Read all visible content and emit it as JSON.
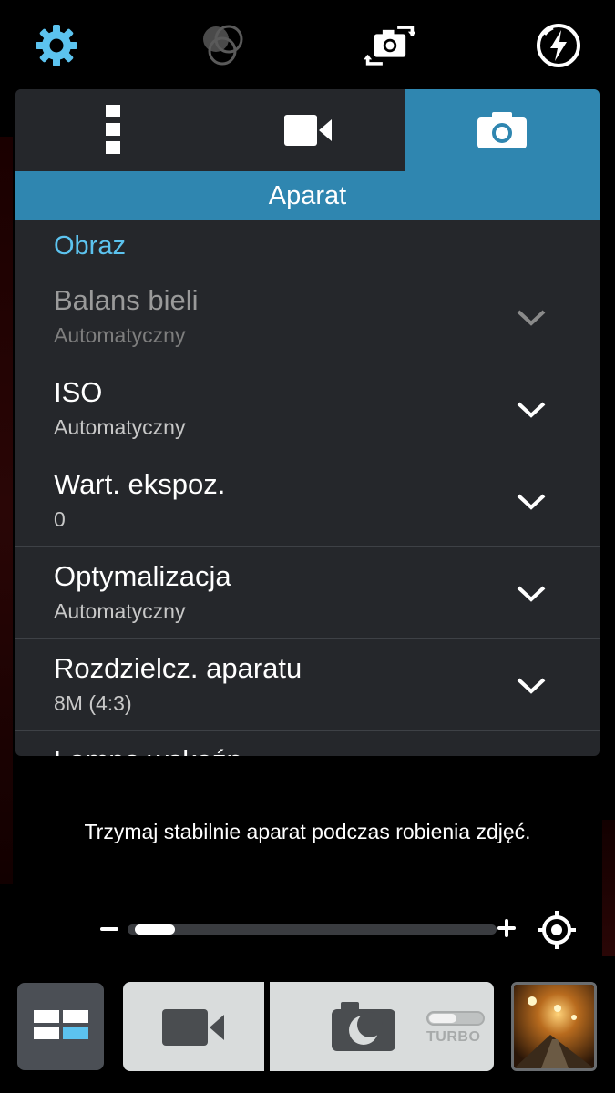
{
  "topbar": {
    "icons": [
      "gear-icon",
      "color-effects-icon",
      "switch-camera-icon",
      "flash-auto-icon"
    ],
    "accent_color": "#5cc3ef"
  },
  "tabs": [
    {
      "icon": "more-vertical-icon",
      "active": false
    },
    {
      "icon": "video-camera-icon",
      "active": false
    },
    {
      "icon": "camera-icon",
      "active": true
    }
  ],
  "panel": {
    "title": "Aparat",
    "section": "Obraz",
    "items": [
      {
        "label": "Balans bieli",
        "value": "Automatyczny",
        "enabled": false
      },
      {
        "label": "ISO",
        "value": "Automatyczny",
        "enabled": true
      },
      {
        "label": "Wart. ekspoz.",
        "value": "0",
        "enabled": true
      },
      {
        "label": "Optymalizacja",
        "value": "Automatyczny",
        "enabled": true
      },
      {
        "label": "Rozdzielcz. aparatu",
        "value": "8M (4:3)",
        "enabled": true
      },
      {
        "label": "Lampa wskaźn",
        "value": "",
        "enabled": true
      }
    ]
  },
  "hint": "Trzymaj stabilnie aparat podczas robienia zdjęć.",
  "zoom": {
    "level": 0.1
  },
  "bottom": {
    "turbo_label": "TURBO",
    "mode_icon": "mode-grid-icon",
    "record_icon": "video-record-icon",
    "shutter_icon": "camera-night-icon",
    "gallery": "gallery-thumbnail"
  },
  "colors": {
    "active_tab": "#2f86b0",
    "panel_bg": "#25272b"
  }
}
